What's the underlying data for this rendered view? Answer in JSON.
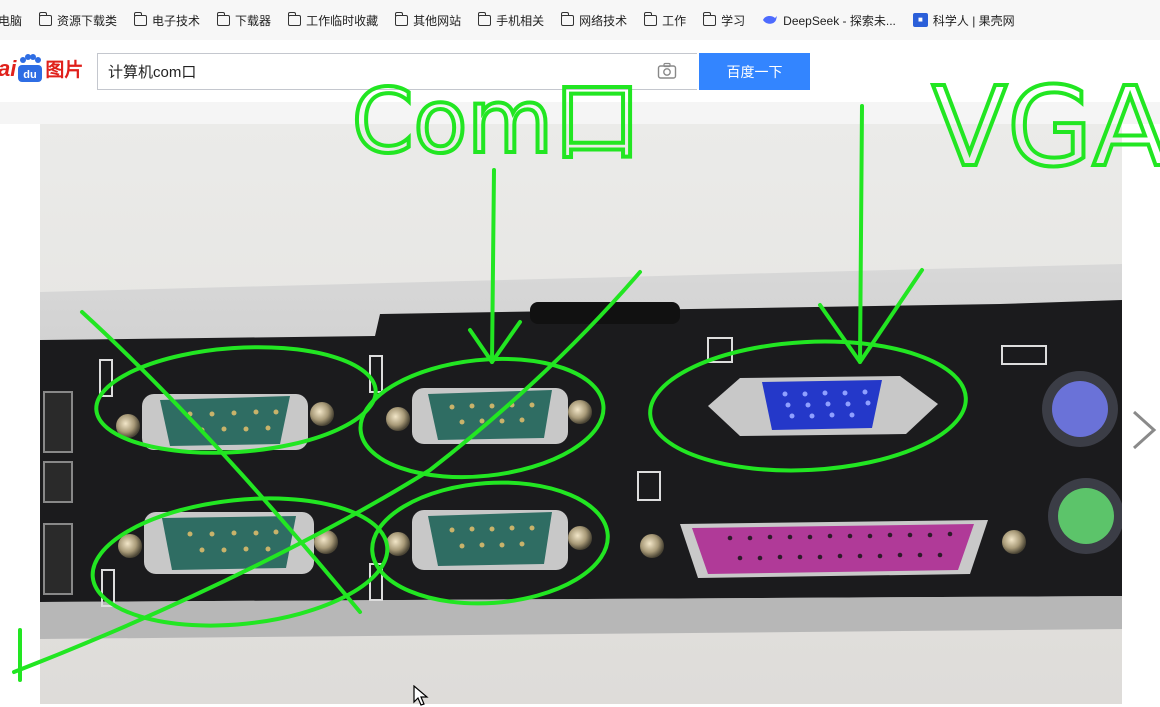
{
  "bookmarks": [
    {
      "label": "电脑",
      "icon": "none"
    },
    {
      "label": "资源下载类",
      "icon": "folder-icon"
    },
    {
      "label": "电子技术",
      "icon": "folder-icon"
    },
    {
      "label": "下载器",
      "icon": "folder-icon"
    },
    {
      "label": "工作临时收藏",
      "icon": "folder-icon"
    },
    {
      "label": "其他网站",
      "icon": "folder-icon"
    },
    {
      "label": "手机相关",
      "icon": "folder-icon"
    },
    {
      "label": "网络技术",
      "icon": "folder-icon"
    },
    {
      "label": "工作",
      "icon": "folder-icon"
    },
    {
      "label": "学习",
      "icon": "folder-icon"
    },
    {
      "label": "DeepSeek - 探索未...",
      "icon": "deepseek-icon"
    },
    {
      "label": "科学人 | 果壳网",
      "icon": "guokr-icon"
    }
  ],
  "logo": {
    "prefix": "ai",
    "suffix": "du",
    "product": "图片"
  },
  "search": {
    "value": "计算机com口",
    "button_label": "百度一下"
  },
  "annotations": {
    "com_label": "Com口",
    "vga_label": "VGA"
  },
  "colors": {
    "accent": "#3385ff",
    "brand_red": "#e0201b",
    "annotation": "#22e622"
  }
}
